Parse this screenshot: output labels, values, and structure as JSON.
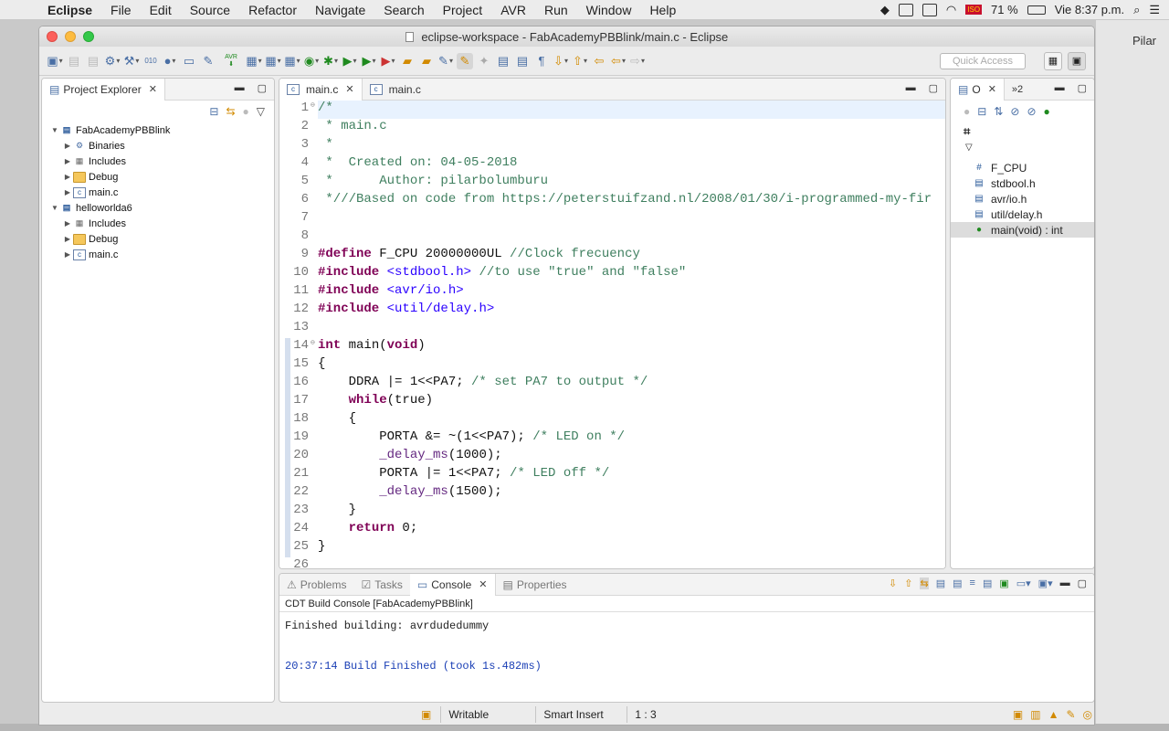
{
  "menubar": {
    "app": "Eclipse",
    "items": [
      "File",
      "Edit",
      "Source",
      "Refactor",
      "Navigate",
      "Search",
      "Project",
      "AVR",
      "Run",
      "Window",
      "Help"
    ],
    "battery": "71 %",
    "clock": "Vie 8:37 p.m.",
    "flag_text": "ISO"
  },
  "background": {
    "tab_label": "Pilar"
  },
  "window": {
    "title": "eclipse-workspace - FabAcademyPBBlink/main.c - Eclipse"
  },
  "toolbar": {
    "quick_access": "Quick Access",
    "avr_label": "AVR"
  },
  "project_explorer": {
    "tab_label": "Project Explorer",
    "rows": [
      {
        "label": "FabAcademyPBBlink",
        "type": "project",
        "expanded": true,
        "level": 0
      },
      {
        "label": "Binaries",
        "type": "binaries",
        "level": 1
      },
      {
        "label": "Includes",
        "type": "includes",
        "level": 1
      },
      {
        "label": "Debug",
        "type": "folder",
        "level": 1
      },
      {
        "label": "main.c",
        "type": "cfile",
        "level": 1
      },
      {
        "label": "helloworlda6",
        "type": "project",
        "expanded": true,
        "level": 0
      },
      {
        "label": "Includes",
        "type": "includes",
        "level": 1
      },
      {
        "label": "Debug",
        "type": "folder",
        "level": 1
      },
      {
        "label": "main.c",
        "type": "cfile",
        "level": 1
      }
    ]
  },
  "editor": {
    "tabs": [
      {
        "label": "main.c",
        "active": true
      },
      {
        "label": "main.c",
        "active": false
      }
    ],
    "lines": [
      {
        "n": "1",
        "t": "/*"
      },
      {
        "n": "2",
        "t": " * main.c"
      },
      {
        "n": "3",
        "t": " *"
      },
      {
        "n": "4",
        "t": " *  Created on: 04-05-2018"
      },
      {
        "n": "5",
        "t": " *      Author: pilarbolumburu"
      },
      {
        "n": "6",
        "t": " *///Based on code from https://peterstuifzand.nl/2008/01/30/i-programmed-my-fir"
      },
      {
        "n": "7",
        "t": ""
      },
      {
        "n": "8",
        "t": ""
      },
      {
        "n": "9",
        "t": "#define F_CPU 20000000UL //Clock frecuency"
      },
      {
        "n": "10",
        "t": "#include <stdbool.h> //to use \"true\" and \"false\""
      },
      {
        "n": "11",
        "t": "#include <avr/io.h>"
      },
      {
        "n": "12",
        "t": "#include <util/delay.h>"
      },
      {
        "n": "13",
        "t": ""
      },
      {
        "n": "14",
        "t": "int main(void)"
      },
      {
        "n": "15",
        "t": "{"
      },
      {
        "n": "16",
        "t": "    DDRA |= 1<<PA7; /* set PA7 to output */"
      },
      {
        "n": "17",
        "t": "    while(true)"
      },
      {
        "n": "18",
        "t": "    {"
      },
      {
        "n": "19",
        "t": "        PORTA &= ~(1<<PA7); /* LED on */"
      },
      {
        "n": "20",
        "t": "        _delay_ms(1000);"
      },
      {
        "n": "21",
        "t": "        PORTA |= 1<<PA7; /* LED off */"
      },
      {
        "n": "22",
        "t": "        _delay_ms(1500);"
      },
      {
        "n": "23",
        "t": "    }"
      },
      {
        "n": "24",
        "t": "    return 0;"
      },
      {
        "n": "25",
        "t": "}"
      },
      {
        "n": "26",
        "t": ""
      }
    ]
  },
  "outline": {
    "tab_label": "O",
    "overflow": "»2",
    "items": [
      {
        "label": "F_CPU",
        "icon": "#"
      },
      {
        "label": "stdbool.h",
        "icon": "include"
      },
      {
        "label": "avr/io.h",
        "icon": "include"
      },
      {
        "label": "util/delay.h",
        "icon": "include"
      },
      {
        "label": "main(void) : int",
        "icon": "function",
        "selected": true
      }
    ]
  },
  "bottom": {
    "tabs": [
      "Problems",
      "Tasks",
      "Console",
      "Properties"
    ],
    "active": "Console",
    "console_label": "CDT Build Console [FabAcademyPBBlink]",
    "lines": [
      "Finished building: avrdudedummy",
      "",
      "20:37:14 Build Finished (took 1s.482ms)"
    ]
  },
  "statusbar": {
    "mode": "Writable",
    "insert": "Smart Insert",
    "position": "1 : 3"
  }
}
